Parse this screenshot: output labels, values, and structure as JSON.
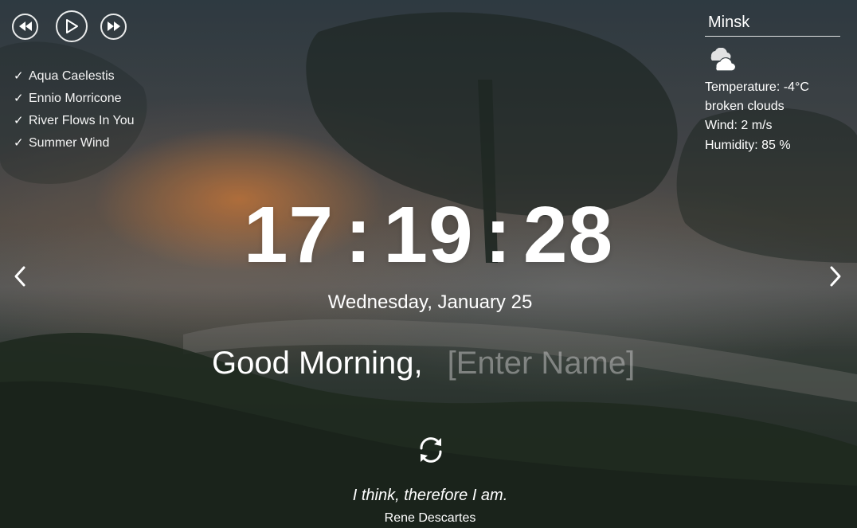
{
  "player": {
    "prev_icon": "rewind-icon",
    "play_icon": "play-icon",
    "next_icon": "fast-forward-icon"
  },
  "playlist": [
    {
      "title": "Aqua Caelestis",
      "checked": true
    },
    {
      "title": "Ennio Morricone",
      "checked": true
    },
    {
      "title": "River Flows In You",
      "checked": true
    },
    {
      "title": "Summer Wind",
      "checked": true
    }
  ],
  "weather": {
    "city": "Minsk",
    "icon": "broken-clouds-icon",
    "temperature": "Temperature: -4°C",
    "description": "broken clouds",
    "wind": "Wind: 2 m/s",
    "humidity": "Humidity: 85 %"
  },
  "clock": {
    "hours": "17",
    "minutes": "19",
    "seconds": "28",
    "separator": ":"
  },
  "date": "Wednesday, January 25",
  "greeting": {
    "text": "Good Morning,",
    "name_placeholder": "[Enter Name]",
    "name_value": ""
  },
  "navigation": {
    "prev_icon": "chevron-left-icon",
    "next_icon": "chevron-right-icon"
  },
  "quote": {
    "refresh_icon": "refresh-icon",
    "text": "I think, therefore I am.",
    "author": "Rene Descartes"
  },
  "colors": {
    "text": "#ffffff",
    "placeholder": "#a8a8a8"
  }
}
